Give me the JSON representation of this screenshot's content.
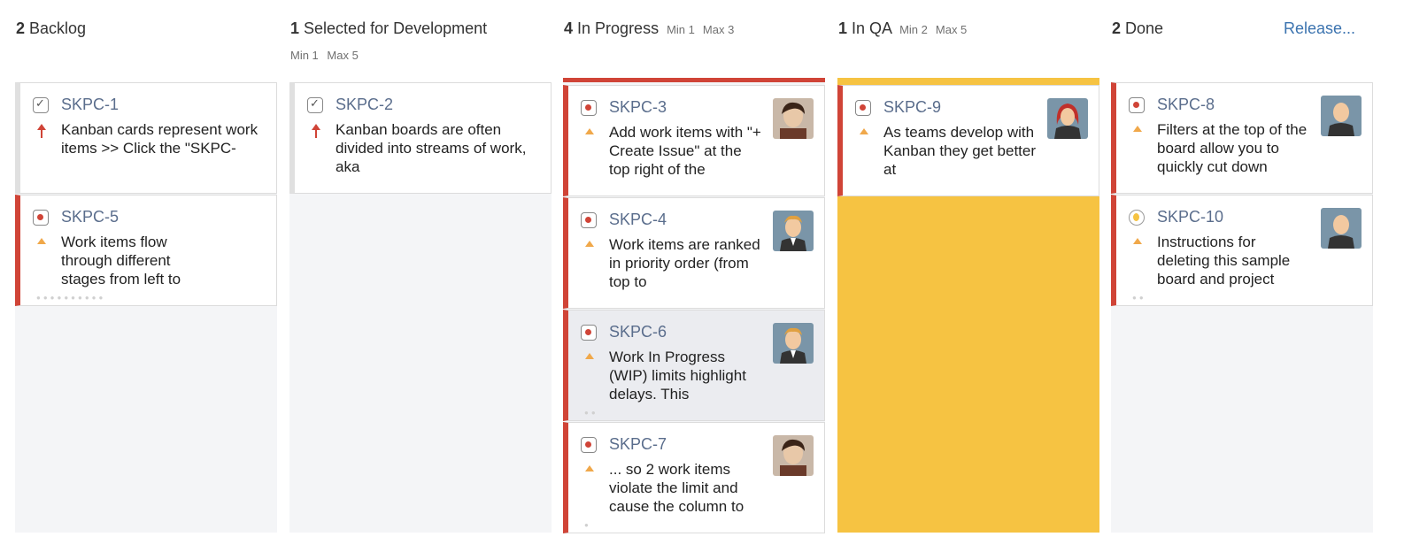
{
  "columns": [
    {
      "count": "2",
      "name": "Backlog",
      "min": "",
      "max": ""
    },
    {
      "count": "1",
      "name": "Selected for Development",
      "min": "Min 1",
      "max": "Max 5"
    },
    {
      "count": "4",
      "name": "In Progress",
      "min": "Min 1",
      "max": "Max 3"
    },
    {
      "count": "1",
      "name": "In QA",
      "min": "Min 2",
      "max": "Max 5"
    },
    {
      "count": "2",
      "name": "Done",
      "min": "",
      "max": ""
    }
  ],
  "release_label": "Release...",
  "cards": {
    "skpc1": {
      "key": "SKPC-1",
      "summary": "Kanban cards represent work items >> Click the \"SKPC-",
      "type": "task-icon",
      "priority": "high-priority-icon"
    },
    "skpc5": {
      "key": "SKPC-5",
      "summary": "Work items flow through different stages from left to",
      "type": "bug-icon",
      "priority": "medium-priority-icon"
    },
    "skpc2": {
      "key": "SKPC-2",
      "summary": "Kanban boards are often divided into streams of work, aka",
      "type": "task-icon",
      "priority": "high-priority-icon"
    },
    "skpc3": {
      "key": "SKPC-3",
      "summary": "Add work items with \"+ Create Issue\" at the top right of the",
      "type": "bug-icon",
      "priority": "medium-priority-icon"
    },
    "skpc4": {
      "key": "SKPC-4",
      "summary": "Work items are ranked in priority order (from top to",
      "type": "bug-icon",
      "priority": "medium-priority-icon"
    },
    "skpc6": {
      "key": "SKPC-6",
      "summary": "Work In Progress (WIP) limits highlight delays. This",
      "type": "bug-icon",
      "priority": "medium-priority-icon"
    },
    "skpc7": {
      "key": "SKPC-7",
      "summary": "... so 2 work items violate the limit and cause the column to",
      "type": "bug-icon",
      "priority": "medium-priority-icon"
    },
    "skpc9": {
      "key": "SKPC-9",
      "summary": "As teams develop with Kanban they get better at",
      "type": "bug-icon",
      "priority": "medium-priority-icon"
    },
    "skpc8": {
      "key": "SKPC-8",
      "summary": "Filters at the top of the board allow you to quickly cut down",
      "type": "bug-icon",
      "priority": "medium-priority-icon"
    },
    "skpc10": {
      "key": "SKPC-10",
      "summary": "Instructions for deleting this sample board and project",
      "type": "improvement-icon",
      "priority": "medium-priority-icon"
    }
  },
  "colors": {
    "wip_exceeded": "#d04437",
    "wip_below": "#f6c342",
    "issue_key": "#5a6d8c",
    "link": "#3b73af"
  }
}
